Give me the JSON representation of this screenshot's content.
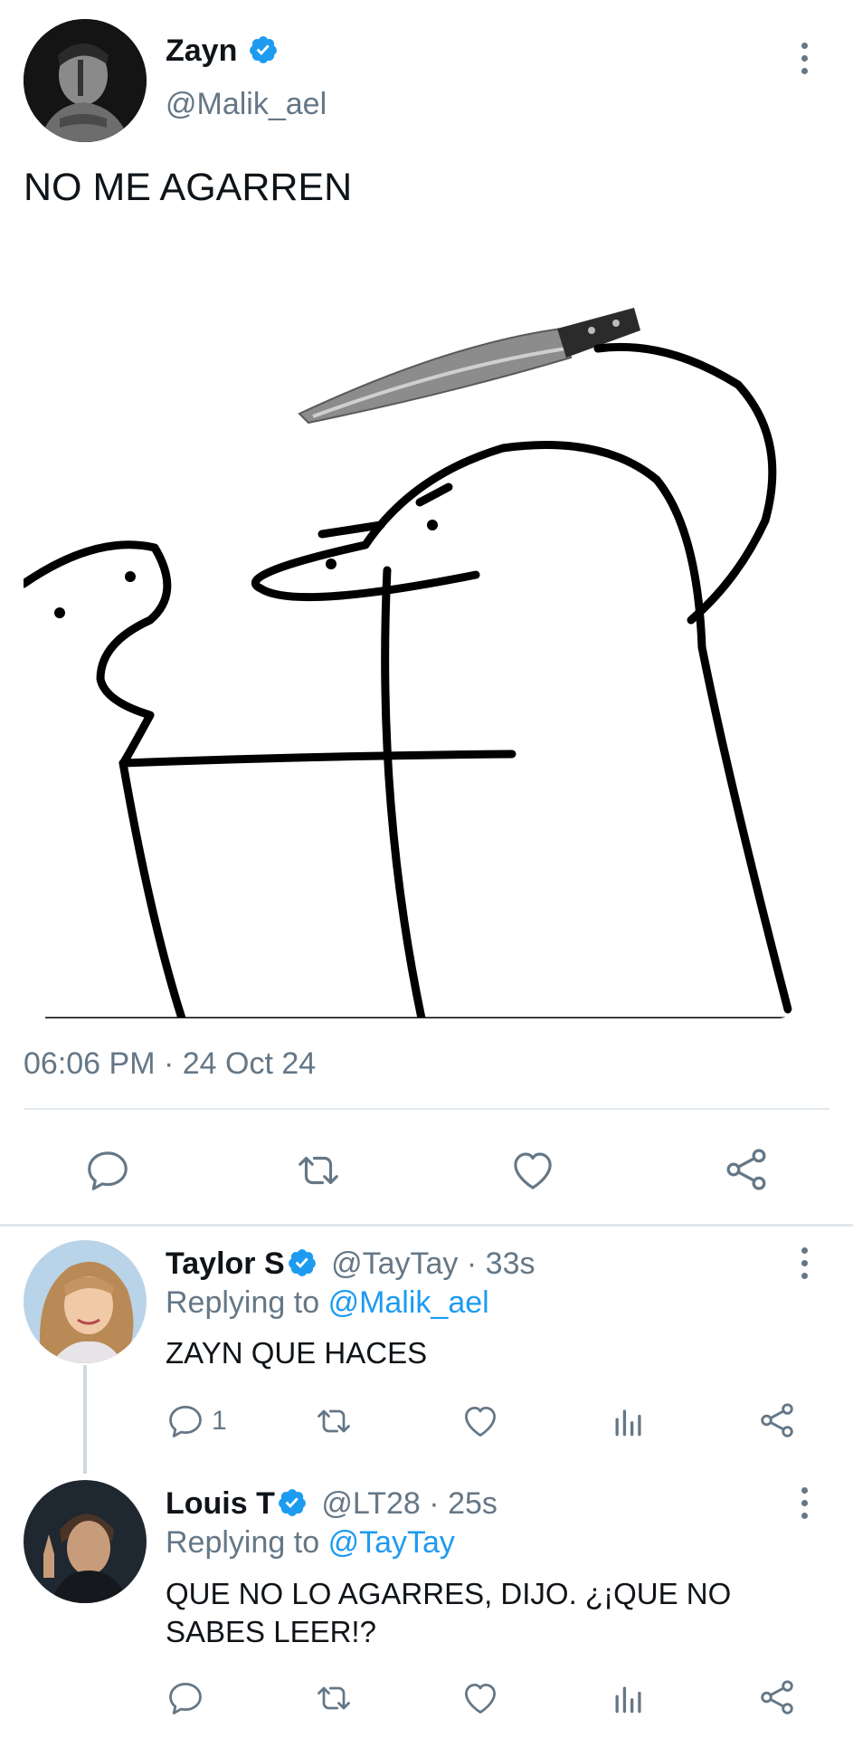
{
  "main_tweet": {
    "author_name": "Zayn",
    "handle": "@Malik_ael",
    "text": "NO ME AGARREN",
    "timestamp": "06:06 PM",
    "separator": "·",
    "date": "24 Oct 24",
    "verified": true
  },
  "replies": [
    {
      "author_name": "Taylor S",
      "handle": "@TayTay",
      "separator": "·",
      "age": "33s",
      "replying_prefix": "Replying to",
      "replying_to": "@Malik_ael",
      "text": "ZAYN QUE HACES",
      "reply_count": "1",
      "verified": true
    },
    {
      "author_name": "Louis T",
      "handle": "@LT28",
      "separator": "·",
      "age": "25s",
      "replying_prefix": "Replying to",
      "replying_to": "@TayTay",
      "text_line1": "QUE NO LO AGARRES, DIJO. ¿¡QUE NO",
      "text_line2": "SABES LEER!?",
      "verified": true
    }
  ],
  "colors": {
    "accent": "#1d9bf0",
    "muted": "#657786",
    "divider": "#e1e8ed",
    "text": "#0f1419"
  },
  "icons": [
    "more-options-icon",
    "reply-icon",
    "retweet-icon",
    "like-icon",
    "share-icon",
    "analytics-icon",
    "verified-badge-icon"
  ]
}
